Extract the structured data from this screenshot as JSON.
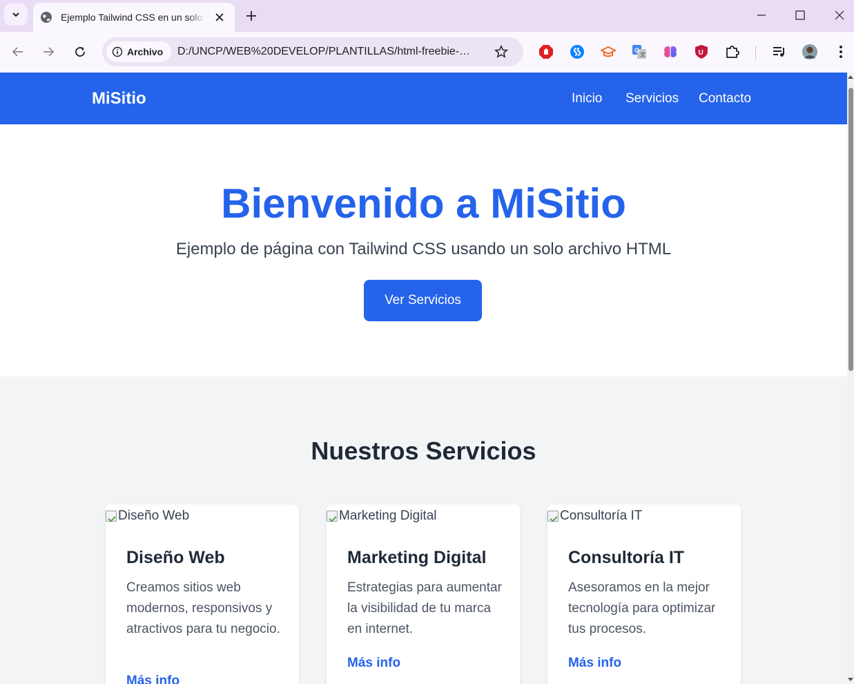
{
  "browser": {
    "tab_title": "Ejemplo Tailwind CSS en un solo archivo",
    "site_chip_label": "Archivo",
    "url": "D:/UNCP/WEB%20DEVELOP/PLANTILLAS/html-freebie-…",
    "extensions": [
      "adblock-icon",
      "shazam-icon",
      "tutor-icon",
      "google-translate-icon",
      "brain-icon",
      "ublock-icon",
      "puzzle-icon"
    ]
  },
  "site": {
    "brand": "MiSitio",
    "nav": [
      "Inicio",
      "Servicios",
      "Contacto"
    ],
    "hero": {
      "title": "Bienvenido a MiSitio",
      "subtitle": "Ejemplo de página con Tailwind CSS usando un solo archivo HTML",
      "cta": "Ver Servicios"
    },
    "services": {
      "title": "Nuestros Servicios",
      "cards": [
        {
          "img_alt": "Diseño Web",
          "title": "Diseño Web",
          "desc": "Creamos sitios web modernos, responsivos y atractivos para tu negocio.",
          "link": "Más info"
        },
        {
          "img_alt": "Marketing Digital",
          "title": "Marketing Digital",
          "desc": "Estrategias para aumentar la visibilidad de tu marca en internet.",
          "link": "Más info"
        },
        {
          "img_alt": "Consultoría IT",
          "title": "Consultoría IT",
          "desc": "Asesoramos en la mejor tecnología para optimizar tus procesos.",
          "link": "Más info"
        }
      ]
    }
  },
  "colors": {
    "primary": "#2563eb",
    "chrome_tabbar": "#e9dcf5",
    "chrome_toolbar": "#fbf7fe",
    "section_bg": "#f3f4f6"
  }
}
